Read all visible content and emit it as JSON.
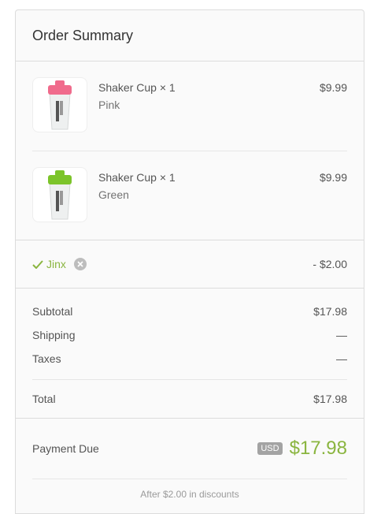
{
  "summary": {
    "title": "Order Summary",
    "items": [
      {
        "name": "Shaker Cup × 1",
        "variant": "Pink",
        "price": "$9.99",
        "lid_color": "#f06b8c"
      },
      {
        "name": "Shaker Cup × 1",
        "variant": "Green",
        "price": "$9.99",
        "lid_color": "#7cc42a"
      }
    ],
    "discount": {
      "code": "Jinx",
      "amount": "- $2.00",
      "icon": "check-icon",
      "remove_icon": "close-icon",
      "color": "#8ab53f"
    },
    "totals": {
      "subtotal_label": "Subtotal",
      "subtotal_value": "$17.98",
      "shipping_label": "Shipping",
      "shipping_value": "—",
      "taxes_label": "Taxes",
      "taxes_value": "—",
      "total_label": "Total",
      "total_value": "$17.98"
    },
    "payment": {
      "label": "Payment Due",
      "currency": "USD",
      "amount": "$17.98",
      "savings_note": "After $2.00 in discounts"
    }
  }
}
